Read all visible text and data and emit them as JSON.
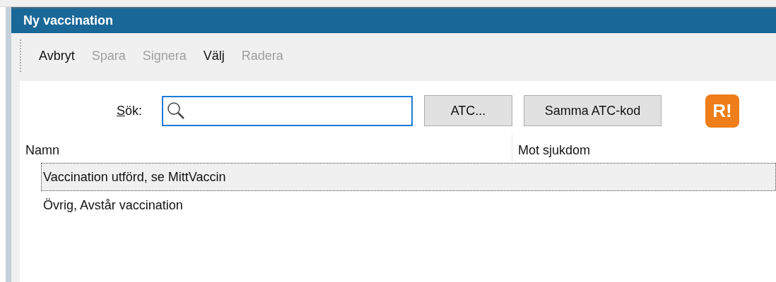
{
  "window": {
    "title": "Ny vaccination"
  },
  "toolbar": [
    {
      "label": "Avbryt",
      "disabled": false
    },
    {
      "label": "Spara",
      "disabled": true
    },
    {
      "label": "Signera",
      "disabled": true
    },
    {
      "label": "Välj",
      "disabled": false
    },
    {
      "label": "Radera",
      "disabled": true
    }
  ],
  "search": {
    "label": "Sök:",
    "buttons": [
      "ATC...",
      "Samma ATC-kod"
    ],
    "logo": "R!"
  },
  "table": {
    "columns": [
      "Namn",
      "Mot sjukdom"
    ],
    "rows": [
      {
        "name": "Vaccination utförd, se MittVaccin",
        "selected": true
      },
      {
        "name": "Övrig, Avstår vaccination",
        "selected": false
      }
    ]
  }
}
